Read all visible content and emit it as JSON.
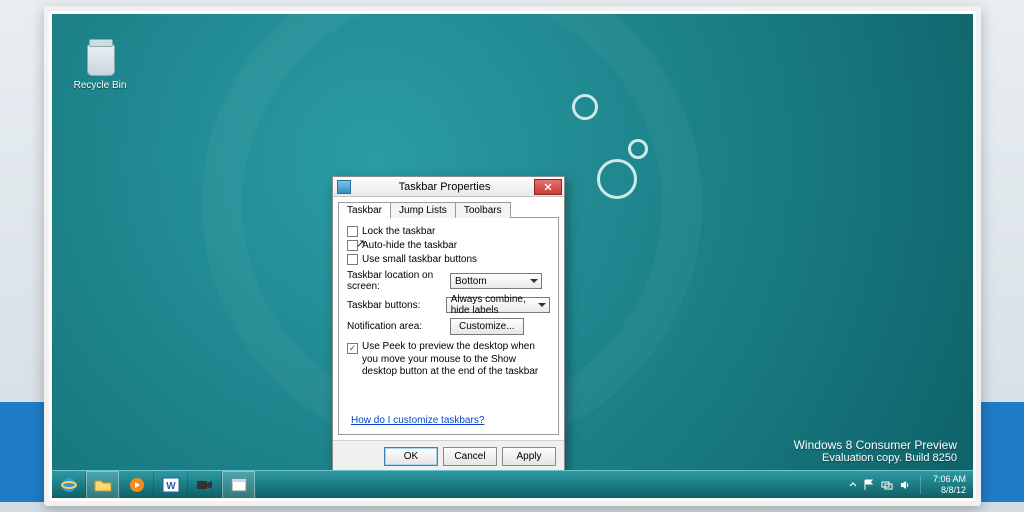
{
  "desktop": {
    "recycle_bin_label": "Recycle Bin"
  },
  "watermark": {
    "line1": "Windows 8 Consumer Preview",
    "line2": "Evaluation copy. Build 8250"
  },
  "clock": {
    "time": "7:06 AM",
    "date": "8/8/12"
  },
  "dialog": {
    "title": "Taskbar Properties",
    "tabs": [
      "Taskbar",
      "Jump Lists",
      "Toolbars"
    ],
    "active_tab": 0,
    "checkboxes": {
      "lock": {
        "label": "Lock the taskbar",
        "checked": false
      },
      "autohide": {
        "label": "Auto-hide the taskbar",
        "checked": false
      },
      "small": {
        "label": "Use small taskbar buttons",
        "checked": false
      }
    },
    "location": {
      "label": "Taskbar location on screen:",
      "value": "Bottom"
    },
    "buttons": {
      "label": "Taskbar buttons:",
      "value": "Always combine, hide labels"
    },
    "notification": {
      "label": "Notification area:",
      "button": "Customize..."
    },
    "peek": {
      "label": "Use Peek to preview the desktop when you move your mouse to the Show desktop button at the end of the taskbar",
      "checked": true
    },
    "help_link": "How do I customize taskbars?",
    "ok": "OK",
    "cancel": "Cancel",
    "apply": "Apply"
  }
}
